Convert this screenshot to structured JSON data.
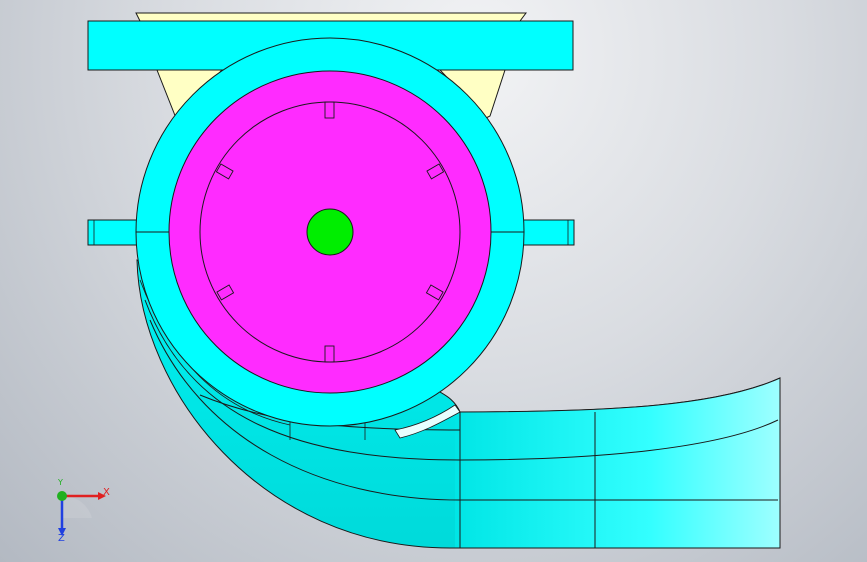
{
  "viewport": {
    "background_top": "#f2f3f5",
    "background_bottom": "#b3b9c2"
  },
  "colors": {
    "housing": "#00ffff",
    "impeller": "#ff2bff",
    "shaft": "#00ee00",
    "support": "#ffffc4",
    "edge": "#1a1a1a"
  },
  "triad": {
    "x_label": "X",
    "y_label": "Y",
    "z_label": "Z",
    "x_color": "#e02020",
    "y_color": "#20b020",
    "z_color": "#2040e0"
  }
}
